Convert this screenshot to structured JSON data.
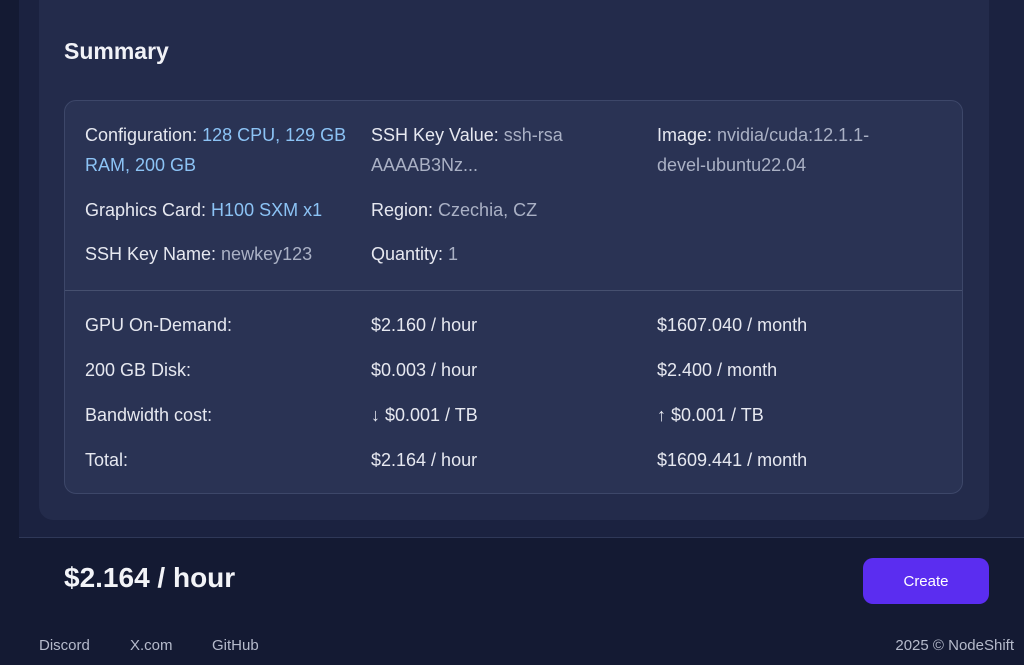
{
  "summary": {
    "title": "Summary",
    "configuration": {
      "label": "Configuration: ",
      "value": "128 CPU, 129 GB RAM, 200 GB"
    },
    "ssh_key_value": {
      "label": "SSH Key Value: ",
      "value": "ssh-rsa AAAAB3Nz..."
    },
    "image": {
      "label": "Image: ",
      "value": "nvidia/cuda:12.1.1-devel-ubuntu22.04"
    },
    "graphics_card": {
      "label": "Graphics Card: ",
      "value": "H100 SXM x1"
    },
    "region": {
      "label": "Region: ",
      "value": "Czechia, CZ"
    },
    "ssh_key_name": {
      "label": "SSH Key Name: ",
      "value": "newkey123"
    },
    "quantity": {
      "label": "Quantity: ",
      "value": "1"
    }
  },
  "pricing": {
    "rows": [
      {
        "label": "GPU On-Demand:",
        "hourly": "$2.160 / hour",
        "monthly": "$1607.040 / month"
      },
      {
        "label": "200 GB Disk:",
        "hourly": "$0.003 / hour",
        "monthly": "$2.400 / month"
      },
      {
        "label": "Bandwidth cost:",
        "hourly": "↓ $0.001 / TB",
        "monthly": "↑ $0.001 / TB"
      },
      {
        "label": "Total:",
        "hourly": "$2.164 / hour",
        "monthly": "$1609.441 / month"
      }
    ]
  },
  "footer": {
    "total_price": "$2.164 / hour",
    "create_label": "Create",
    "links": [
      "Discord",
      "X.com",
      "GitHub"
    ],
    "copyright": "2025 © NodeShift"
  },
  "colors": {
    "accent": "#5b2df0",
    "link": "#8cc3f5",
    "background": "#141a33"
  }
}
